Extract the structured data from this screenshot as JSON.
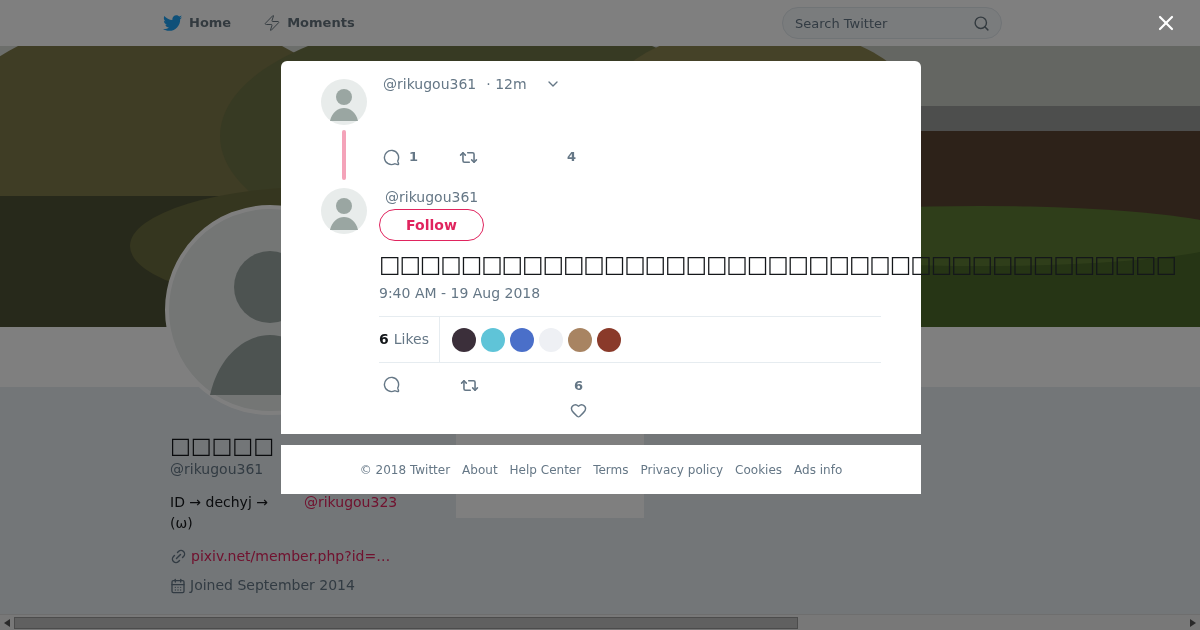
{
  "nav": {
    "items": [
      {
        "label": "Home",
        "kind": "home"
      },
      {
        "label": "Moments",
        "kind": "moments"
      }
    ],
    "search": {
      "placeholder": "Search Twitter"
    }
  },
  "profile": {
    "name": "□□□□□",
    "handle": "@rikugou361",
    "bio": "ID → dechyj  →",
    "bio_mention": "@rikugou323",
    "bio_line2": "(ω)",
    "link": "pixiv.net/member.php?id=…",
    "joined": "Joined September 2014"
  },
  "modal": {
    "parent_tweet": {
      "handle": "@rikugou361",
      "time": "· 12m",
      "reply_count": "1",
      "like_count": "4"
    },
    "tweet": {
      "handle": "@rikugou361",
      "follow_label": "Follow",
      "text": "□□□□□□□□□□□□□□□□□□□□□□□□□□□□□□□□□□□□□□□",
      "timestamp": "9:40 AM - 19 Aug 2018",
      "likes_count": "6",
      "likes_label": "Likes",
      "likers": [
        {
          "color": "#3b2f3a"
        },
        {
          "color": "#5fc4d8"
        },
        {
          "color": "#4a6fc9"
        },
        {
          "color": "#eef0f4"
        },
        {
          "color": "#a88462"
        },
        {
          "color": "#8a3a2a"
        }
      ],
      "like_count": "6"
    }
  },
  "footer": {
    "links": [
      "© 2018 Twitter",
      "About",
      "Help Center",
      "Terms",
      "Privacy policy",
      "Cookies",
      "Ads info"
    ]
  }
}
